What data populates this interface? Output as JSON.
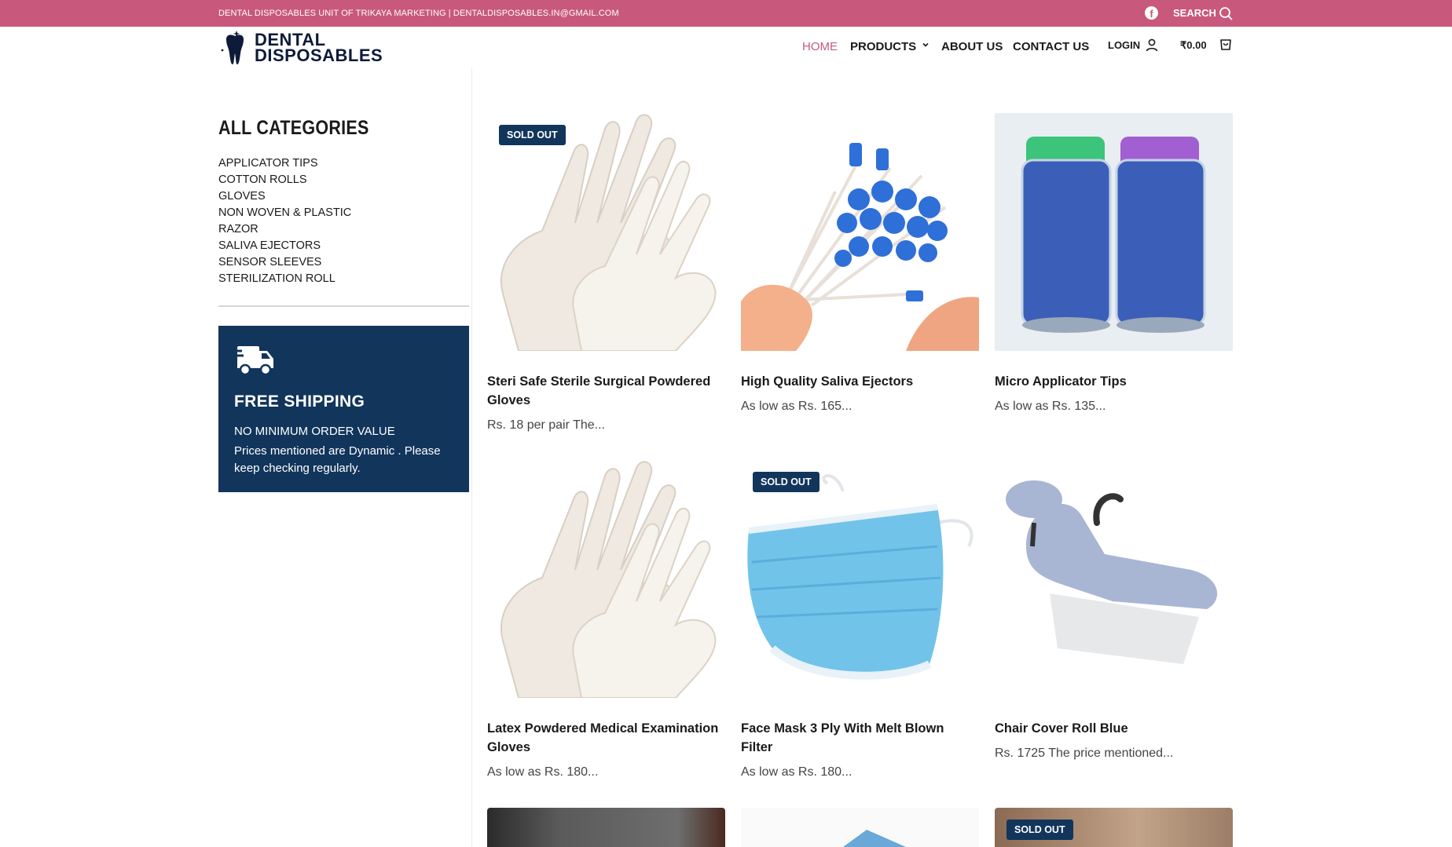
{
  "topbar": {
    "info": "DENTAL DISPOSABLES UNIT OF TRIKAYA MARKETING |  DENTALDISPOSABLES.IN@GMAIL.COM",
    "search_label": "SEARCH"
  },
  "logo": {
    "line1": "DENTAL",
    "line2": "DISPOSABLES"
  },
  "nav": {
    "home": "HOME",
    "products": "PRODUCTS",
    "about": "ABOUT US",
    "contact": "CONTACT US",
    "login": "LOGIN",
    "cart_total": "₹0.00"
  },
  "sidebar": {
    "title": "ALL CATEGORIES",
    "categories": [
      "APPLICATOR TIPS",
      "COTTON ROLLS",
      "GLOVES",
      "NON WOVEN & PLASTIC",
      "RAZOR",
      "SALIVA EJECTORS",
      "SENSOR SLEEVES",
      "STERILIZATION ROLL"
    ],
    "shipping": {
      "heading": "FREE SHIPPING",
      "line1": "NO MINIMUM ORDER VALUE",
      "line2": "Prices mentioned are Dynamic . Please keep checking regularly."
    }
  },
  "badge_label": "SOLD OUT",
  "products": [
    {
      "title": "Steri Safe Sterile Surgical Powdered Gloves",
      "price": "Rs. 18 per pair The...",
      "sold_out": true
    },
    {
      "title": "High Quality Saliva Ejectors",
      "price": "As low as Rs. 165...",
      "sold_out": false
    },
    {
      "title": "Micro Applicator Tips",
      "price": "As low as Rs. 135...",
      "sold_out": false
    },
    {
      "title": "Latex Powdered Medical Examination Gloves",
      "price": "As low as Rs. 180...",
      "sold_out": false
    },
    {
      "title": "Face Mask 3 Ply With Melt Blown Filter",
      "price": "As low as Rs. 180...",
      "sold_out": true
    },
    {
      "title": "Chair Cover Roll Blue",
      "price": "Rs. 1725 The price mentioned...",
      "sold_out": false
    }
  ],
  "colors": {
    "brand_pink": "#c9587d",
    "navy": "#12355b"
  }
}
